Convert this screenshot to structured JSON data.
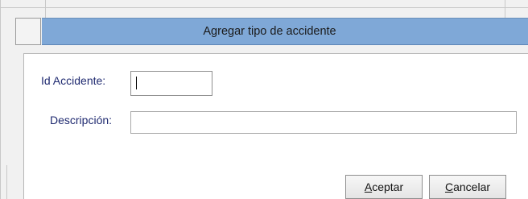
{
  "form": {
    "title": "Agregar tipo de accidente",
    "fields": {
      "id_label": "Id Accidente:",
      "id_value": "",
      "descripcion_label": "Descripción:",
      "descripcion_value": ""
    },
    "buttons": {
      "accept_mnemonic": "A",
      "accept_rest": "ceptar",
      "cancel_mnemonic": "C",
      "cancel_rest": "ancelar"
    }
  },
  "colors": {
    "header_bg": "#7fa8d7",
    "label_text": "#1f2a70",
    "detail_bg": "#ffffff",
    "window_bg": "#f1f1f1"
  }
}
